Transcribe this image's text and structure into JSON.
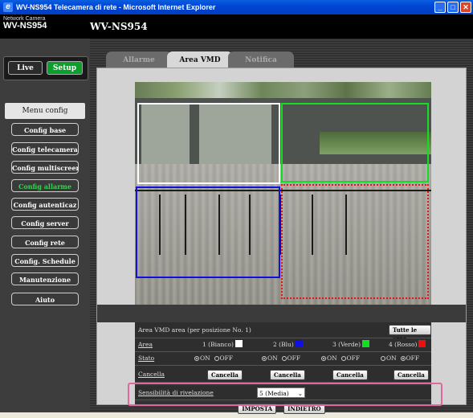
{
  "window": {
    "title": "WV-NS954 Telecamera di rete - Microsoft Internet Explorer"
  },
  "header": {
    "brand_small": "Network Camera",
    "brand_big": "WV-NS954",
    "model": "WV-NS954"
  },
  "mode": {
    "live": "Live",
    "setup": "Setup"
  },
  "nav": {
    "heading": "Menu config",
    "items": [
      "Config base",
      "Config telecamera",
      "Config multiscreen",
      "Config allarme",
      "Config autenticaz",
      "Config server",
      "Config rete",
      "Config. Schedule",
      "Manutenzione"
    ],
    "active_index": 3,
    "help": "Aiuto"
  },
  "tabs": [
    "Allarme",
    "Area VMD",
    "Notifica"
  ],
  "active_tab": 1,
  "vmd": {
    "title": "Area VMD area (per posizione No. 1)",
    "all_areas_button": "Tutte le aree",
    "area_label": "Area",
    "areas": [
      {
        "label": "1 (Bianco)",
        "color": "#ffffff",
        "state": "ON"
      },
      {
        "label": "2 (Blu)",
        "color": "#1010e0",
        "state": "ON"
      },
      {
        "label": "3 (Verde)",
        "color": "#10e020",
        "state": "ON"
      },
      {
        "label": "4 (Rosso)",
        "color": "#ee1010",
        "state": "OFF"
      }
    ],
    "state_label": "Stato",
    "on_label": "ON",
    "off_label": "OFF",
    "delete_label": "Cancella",
    "delete_button": "Cancella",
    "sensitivity_label": "Sensibilità di rivelazione",
    "sensitivity_value": "5 (Media)",
    "set_button": "IMPOSTA",
    "back_button": "INDIETRO"
  },
  "colors": {
    "highlight": "#e0689f",
    "setup_green": "#0a9e2a",
    "active_nav": "#35d24f"
  }
}
